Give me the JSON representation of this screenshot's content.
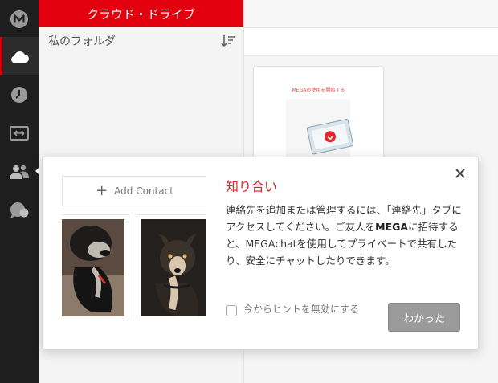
{
  "rail": {
    "items": [
      {
        "name": "mega-logo-icon"
      },
      {
        "name": "cloud-drive-icon",
        "active": true
      },
      {
        "name": "recents-clock-icon"
      },
      {
        "name": "transfers-icon"
      },
      {
        "name": "contacts-icon"
      },
      {
        "name": "chat-icon"
      }
    ]
  },
  "folder_panel": {
    "header": "クラウド・ドライブ",
    "title": "私のフォルダ",
    "sort_icon": "sort-icon"
  },
  "tile": {
    "text": "MEGAの使用を開始する"
  },
  "dialog": {
    "add_contact_label": "Add Contact",
    "title": "知り合い",
    "body_1": "連絡先を追加または管理するには、「連絡先」タブにアクセスしてください。ご友人を",
    "brand_1": "MEGA",
    "body_2": "に招待すると、MEGAchatを使用してプライベートで共有したり、安全にチャットしたりできます。",
    "checkbox_label": "今からヒントを無効にする",
    "checkbox_checked": false,
    "ok_button": "わかった"
  },
  "colors": {
    "brand_red": "#e3000f",
    "rail_bg": "#1e1e1e",
    "title_red": "#d9232a",
    "button_gray": "#9b9b9b"
  }
}
